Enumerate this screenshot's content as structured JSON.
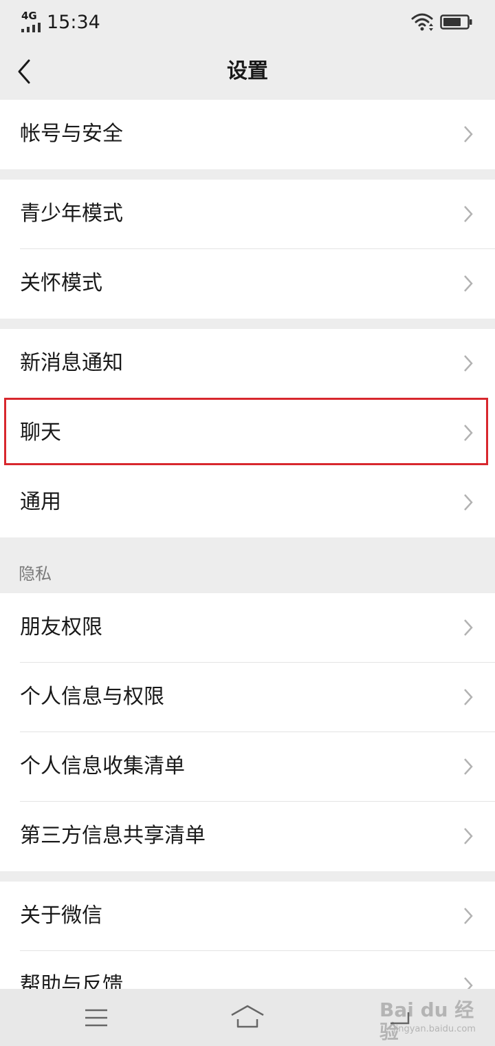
{
  "status_bar": {
    "network": "4G",
    "time": "15:34"
  },
  "header": {
    "title": "设置"
  },
  "groups": [
    {
      "items": [
        {
          "label": "帐号与安全"
        }
      ]
    },
    {
      "items": [
        {
          "label": "青少年模式"
        },
        {
          "label": "关怀模式"
        }
      ]
    },
    {
      "items": [
        {
          "label": "新消息通知"
        },
        {
          "label": "聊天"
        },
        {
          "label": "通用"
        }
      ]
    },
    {
      "section_label": "隐私",
      "items": [
        {
          "label": "朋友权限"
        },
        {
          "label": "个人信息与权限"
        },
        {
          "label": "个人信息收集清单"
        },
        {
          "label": "第三方信息共享清单"
        }
      ]
    },
    {
      "items": [
        {
          "label": "关于微信"
        },
        {
          "label": "帮助与反馈"
        }
      ]
    }
  ],
  "highlighted_item": "聊天",
  "system_nav": {
    "buttons": [
      "menu-icon",
      "home-icon",
      "back-icon"
    ]
  },
  "watermark": {
    "main": "Bai du 经验",
    "sub": "jingyan.baidu.com"
  },
  "colors": {
    "background": "#ededed",
    "highlight": "#d8272d",
    "text": "#191919",
    "chevron": "#b2b2b2"
  }
}
